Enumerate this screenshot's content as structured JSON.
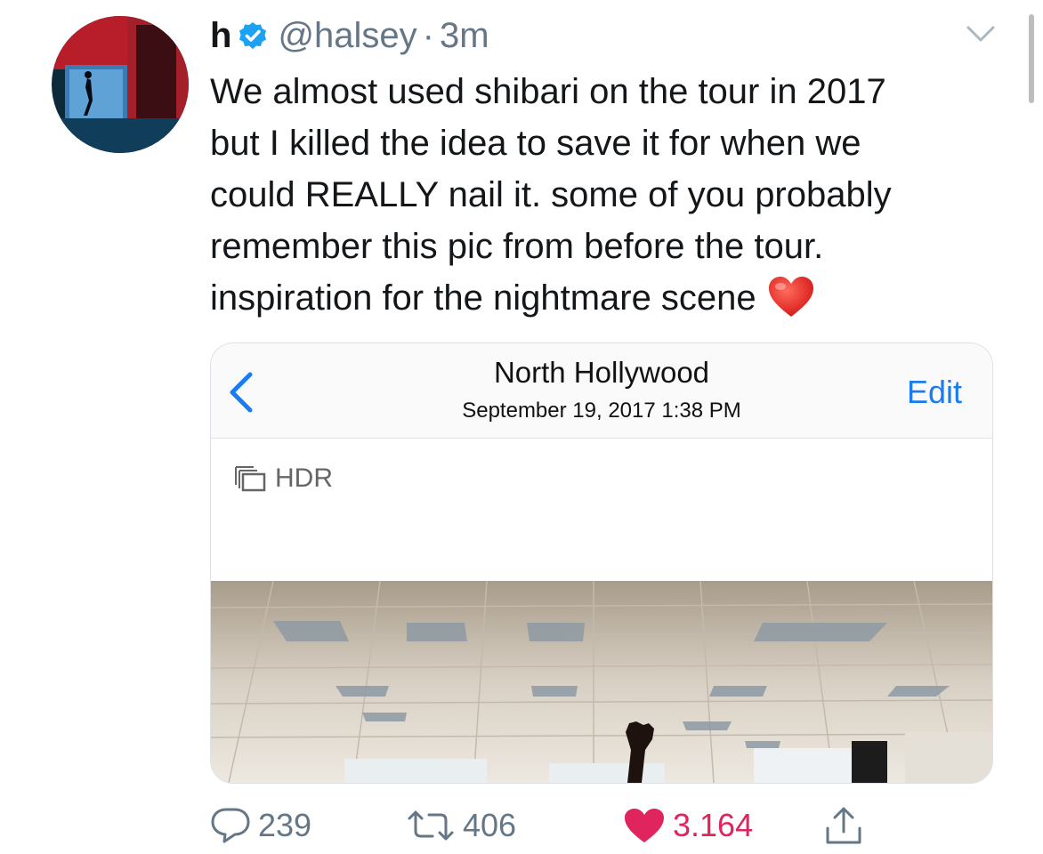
{
  "tweet": {
    "author_name": "h",
    "handle": "@halsey",
    "separator": "·",
    "time": "3m",
    "text_lines": [
      "We almost used shibari on the tour in 2017",
      "but I killed the idea to save it for when we",
      "could REALLY nail it. some of you probably",
      "remember this pic from before the tour.",
      "inspiration for the nightmare scene"
    ],
    "verified": true,
    "icons": {
      "verified": "verified-badge-icon",
      "menu": "chevron-down-icon",
      "emoji": "red-heart-emoji"
    }
  },
  "embedded_screenshot": {
    "title": "North Hollywood",
    "subtitle": "September 19, 2017  1:38 PM",
    "edit_label": "Edit",
    "hdr_label": "HDR",
    "back_icon": "chevron-left-icon",
    "accent_color": "#1b7cf1"
  },
  "actions": {
    "replies": "239",
    "retweets": "406",
    "likes": "3.164",
    "reply_icon": "reply-bubble-icon",
    "retweet_icon": "retweet-icon",
    "like_icon": "heart-icon",
    "share_icon": "share-icon",
    "like_color": "#e0245e",
    "muted_color": "#657786"
  }
}
